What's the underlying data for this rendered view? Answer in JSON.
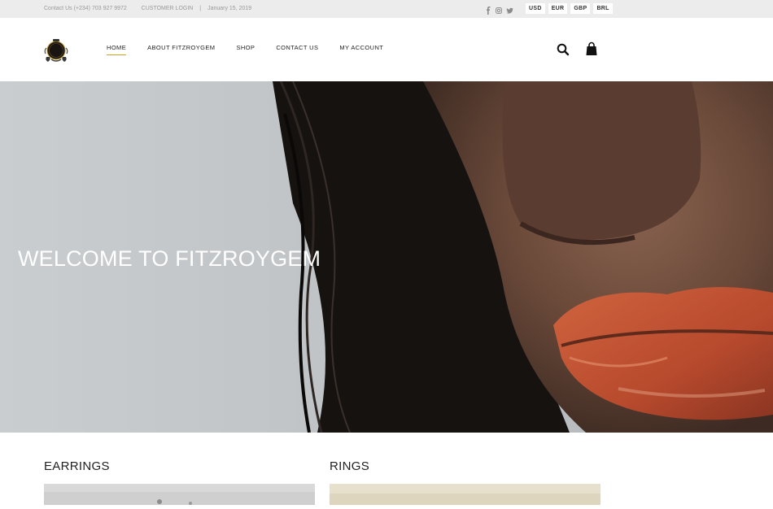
{
  "topbar": {
    "contact": "Contact Us (+234) 703 927 9972",
    "login": "CUSTOMER LOGIN",
    "separator": "|",
    "date": "January 15, 2019",
    "social_icons": [
      "facebook-icon",
      "instagram-icon",
      "twitter-icon"
    ],
    "currencies": [
      "USD",
      "EUR",
      "GBP",
      "BRL"
    ]
  },
  "header": {
    "nav": [
      "HOME",
      "ABOUT FITZROYGEM",
      "SHOP",
      "CONTACT US",
      "MY ACCOUNT"
    ],
    "active_nav": "HOME",
    "icons": [
      "search-icon",
      "shopping-bag-icon"
    ]
  },
  "hero": {
    "title": "WELCOME TO FITZROYGEM"
  },
  "categories": [
    {
      "title": "EARRINGS"
    },
    {
      "title": "RINGS"
    }
  ],
  "colors": {
    "accent": "#c9a227",
    "topbar_bg": "#ececec"
  }
}
